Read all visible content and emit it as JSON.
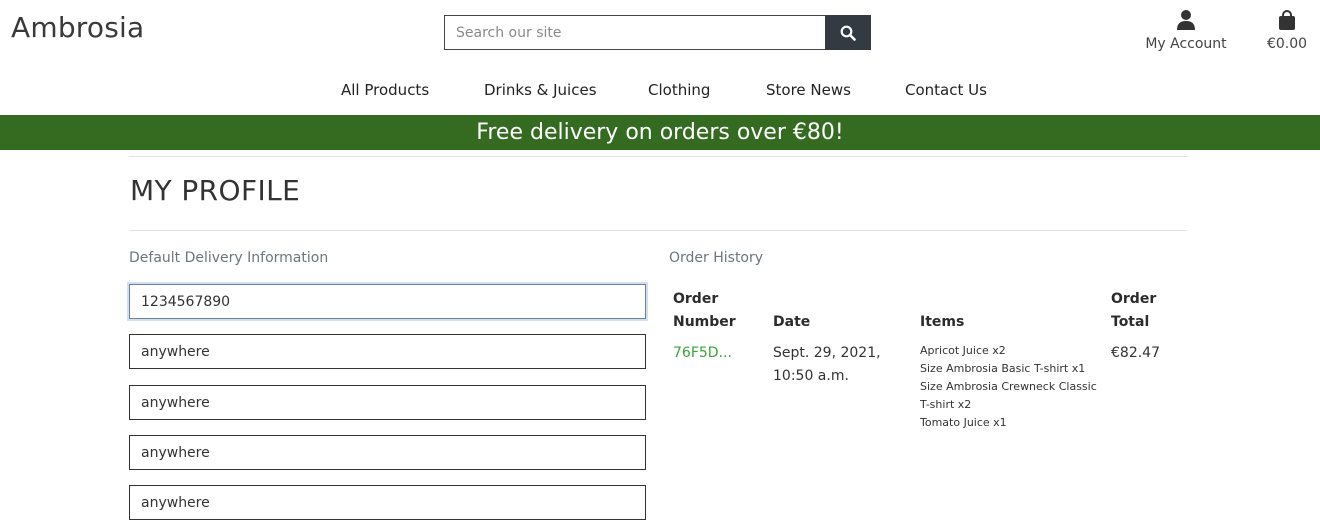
{
  "brand": {
    "logo": "Ambrosia"
  },
  "search": {
    "placeholder": "Search our site"
  },
  "account": {
    "label": "My Account"
  },
  "bag": {
    "total": "€0.00"
  },
  "nav": {
    "items": [
      "All Products",
      "Drinks & Juices",
      "Clothing",
      "Store News",
      "Contact Us"
    ]
  },
  "banner": {
    "text": "Free delivery on orders over €80!"
  },
  "page": {
    "title": "MY PROFILE"
  },
  "delivery": {
    "heading": "Default Delivery Information",
    "fields": [
      "1234567890",
      "anywhere",
      "anywhere",
      "anywhere",
      "anywhere"
    ]
  },
  "orders": {
    "heading": "Order History",
    "columns": {
      "number_l1": "Order",
      "number_l2": "Number",
      "date": "Date",
      "items": "Items",
      "total_l1": "Order",
      "total_l2": "Total"
    },
    "rows": [
      {
        "number": "76F5D...",
        "date_l1": "Sept. 29, 2021,",
        "date_l2": "10:50 a.m.",
        "items": [
          "Apricot Juice x2",
          "Size Ambrosia Basic T-shirt x1",
          "Size Ambrosia Crewneck Classic T-shirt x2",
          "Tomato Juice x1"
        ],
        "total": "€82.47"
      }
    ]
  },
  "colors": {
    "banner": "#346b21",
    "order_link": "#3aa33a",
    "search_button": "#333a41"
  }
}
